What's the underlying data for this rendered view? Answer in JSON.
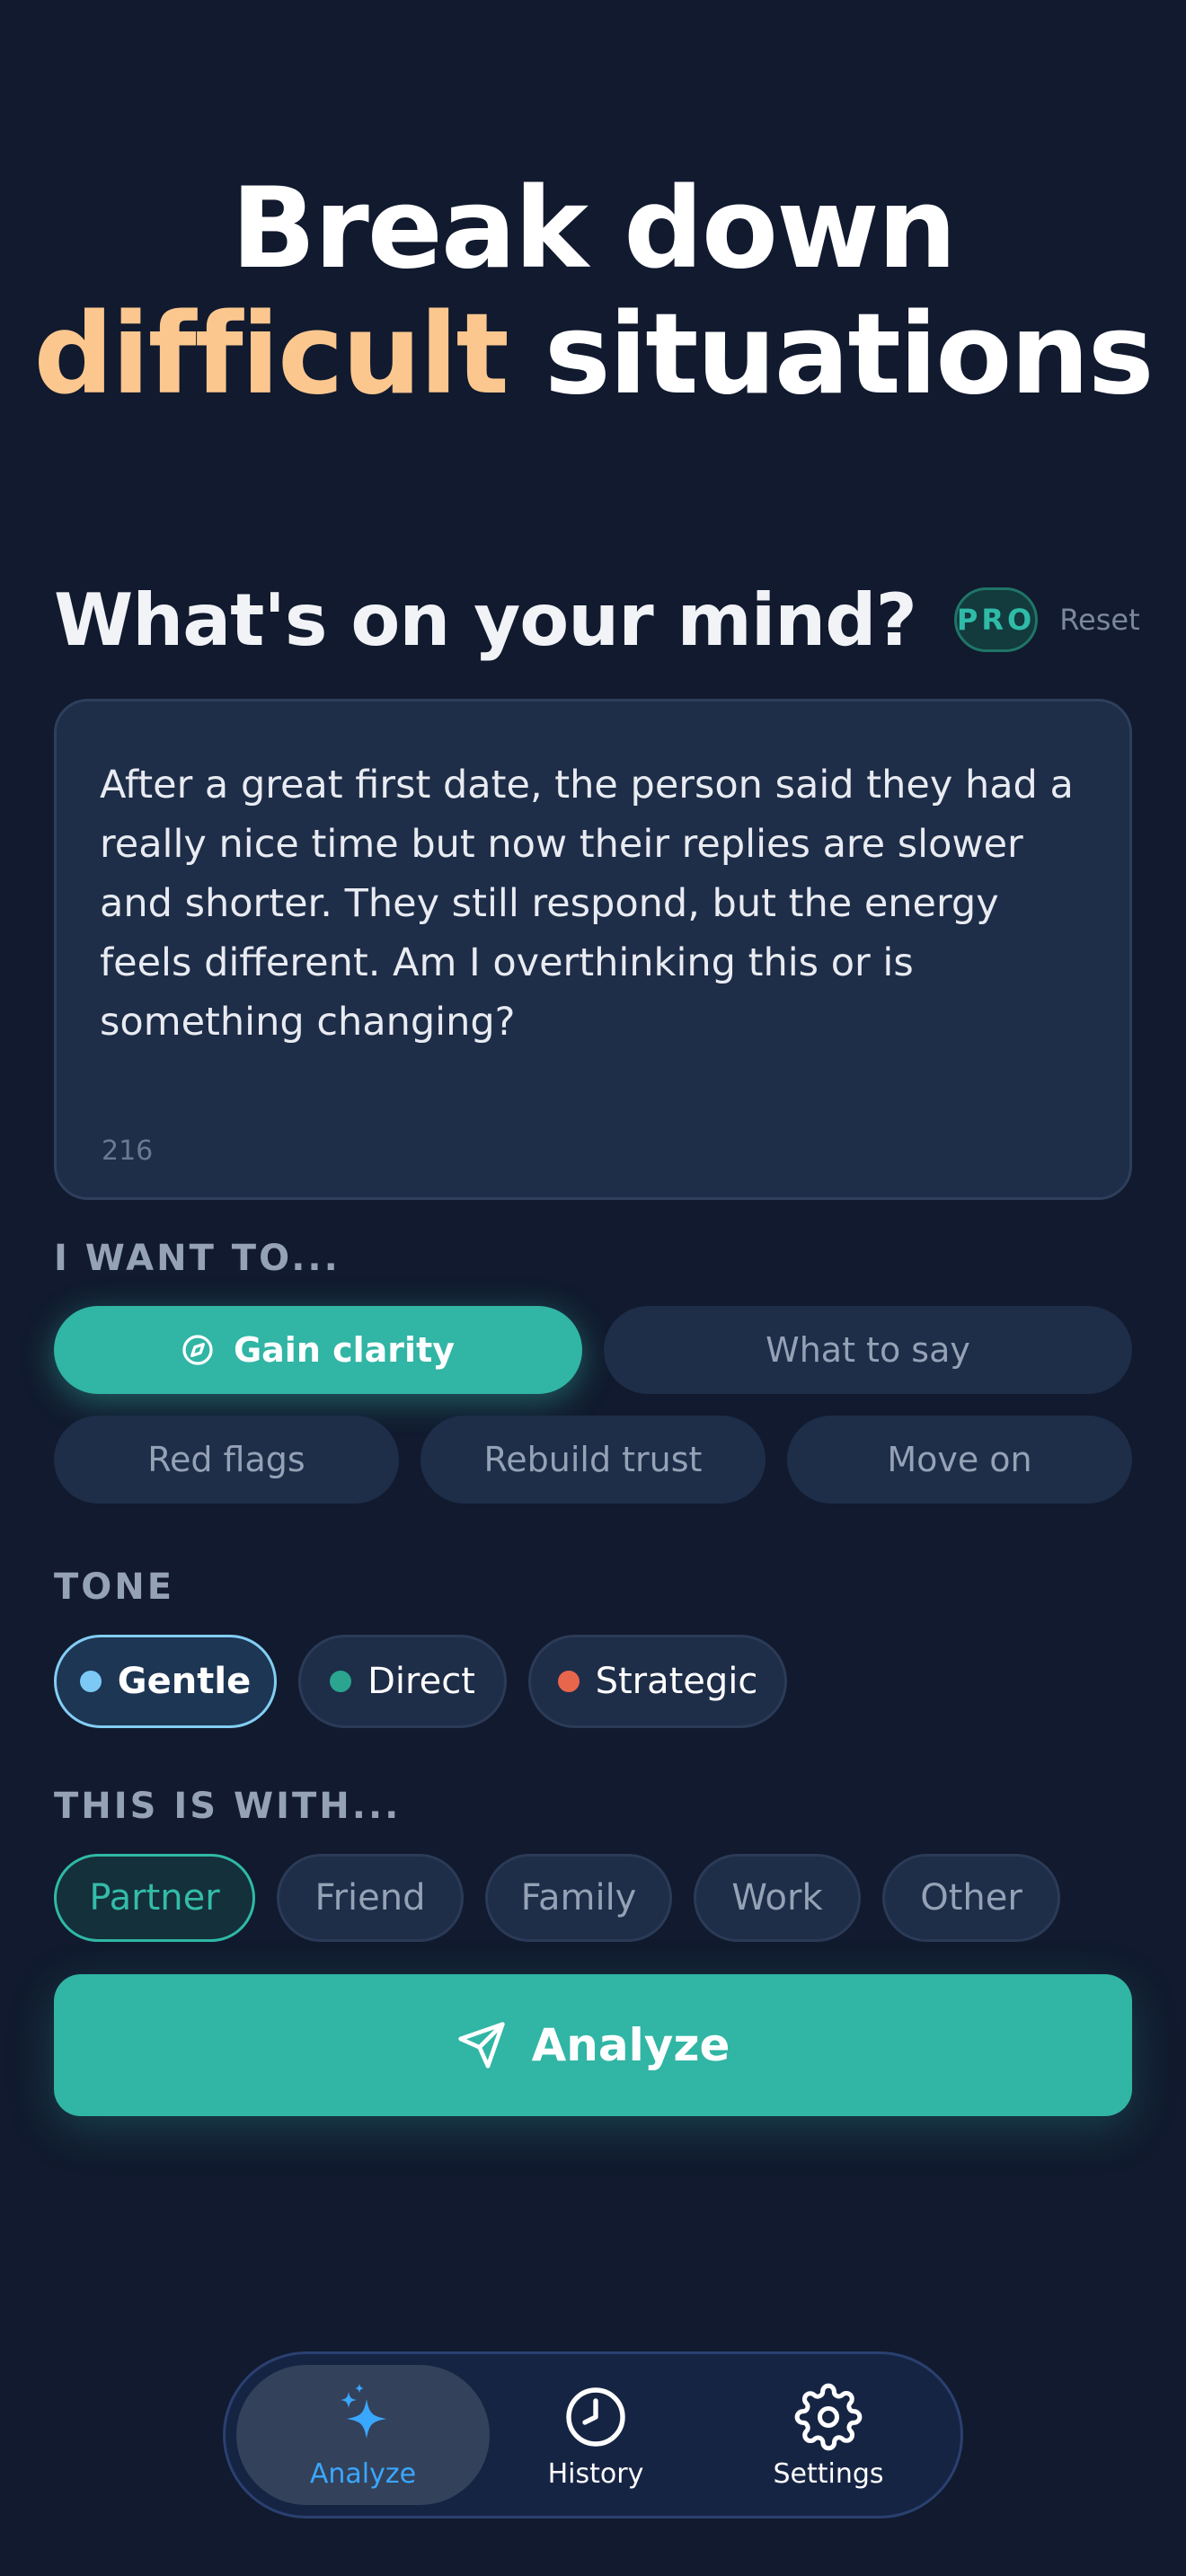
{
  "hero": {
    "line1": "Break down",
    "accent": "difficult",
    "rest": "situations"
  },
  "prompt": {
    "title": "What's on your mind?",
    "pro_badge": "PRO",
    "reset": "Reset"
  },
  "textarea": {
    "value": "After a great first date, the person said they had a really nice time but now their replies are slower and shorter. They still respond, but the energy feels different. Am I overthinking this or is something changing?",
    "char_count": "216"
  },
  "goals": {
    "label": "I WANT TO...",
    "items": [
      "Gain clarity",
      "What to say",
      "Red flags",
      "Rebuild trust",
      "Move on"
    ],
    "selected": "Gain clarity"
  },
  "tone": {
    "label": "TONE",
    "items": [
      {
        "label": "Gentle",
        "color": "#7cc9f5"
      },
      {
        "label": "Direct",
        "color": "#2ba58f"
      },
      {
        "label": "Strategic",
        "color": "#e8664b"
      }
    ],
    "selected": "Gentle"
  },
  "relationship": {
    "label": "THIS IS WITH...",
    "items": [
      "Partner",
      "Friend",
      "Family",
      "Work",
      "Other"
    ],
    "selected": "Partner"
  },
  "analyze_button": {
    "label": "Analyze"
  },
  "tabbar": {
    "items": [
      {
        "label": "Analyze",
        "icon": "sparkles-icon"
      },
      {
        "label": "History",
        "icon": "clock-icon"
      },
      {
        "label": "Settings",
        "icon": "gear-icon"
      }
    ],
    "active": "Analyze"
  },
  "colors": {
    "background": "#111a2e",
    "accent_teal": "#31b5a5",
    "accent_peach": "#fcc78f",
    "active_tab_blue": "#3aa7ff"
  }
}
